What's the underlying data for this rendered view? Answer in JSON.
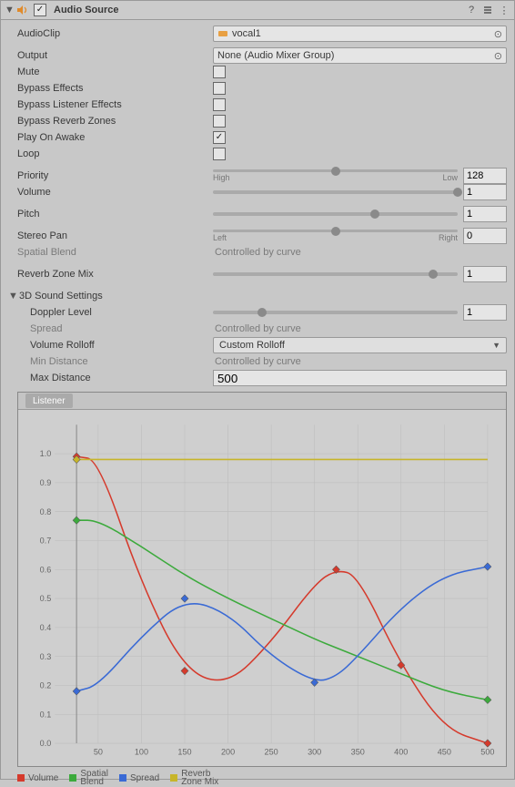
{
  "header": {
    "title": "Audio Source",
    "enabled": true
  },
  "audioClip": {
    "label": "AudioClip",
    "value": "vocal1"
  },
  "output": {
    "label": "Output",
    "value": "None (Audio Mixer Group)"
  },
  "mute": {
    "label": "Mute",
    "checked": false
  },
  "bypassEffects": {
    "label": "Bypass Effects",
    "checked": false
  },
  "bypassListener": {
    "label": "Bypass Listener Effects",
    "checked": false
  },
  "bypassReverb": {
    "label": "Bypass Reverb Zones",
    "checked": false
  },
  "playOnAwake": {
    "label": "Play On Awake",
    "checked": true
  },
  "loop": {
    "label": "Loop",
    "checked": false
  },
  "priority": {
    "label": "Priority",
    "value": "128",
    "min": "High",
    "max": "Low",
    "fraction": 0.5
  },
  "volume": {
    "label": "Volume",
    "value": "1",
    "fraction": 1.0
  },
  "pitch": {
    "label": "Pitch",
    "value": "1",
    "fraction": 0.66
  },
  "stereoPan": {
    "label": "Stereo Pan",
    "value": "0",
    "min": "Left",
    "max": "Right",
    "fraction": 0.5
  },
  "spatialBlend": {
    "label": "Spatial Blend",
    "value": "Controlled by curve"
  },
  "reverbZoneMix": {
    "label": "Reverb Zone Mix",
    "value": "1",
    "fraction": 0.9
  },
  "section3d": {
    "title": "3D Sound Settings"
  },
  "doppler": {
    "label": "Doppler Level",
    "value": "1",
    "fraction": 0.2
  },
  "spread": {
    "label": "Spread",
    "value": "Controlled by curve"
  },
  "volumeRolloff": {
    "label": "Volume Rolloff",
    "value": "Custom Rolloff"
  },
  "minDistance": {
    "label": "Min Distance",
    "value": "Controlled by curve"
  },
  "maxDistance": {
    "label": "Max Distance",
    "value": "500"
  },
  "curveTab": "Listener",
  "yTicks": [
    "1.0",
    "0.9",
    "0.8",
    "0.7",
    "0.6",
    "0.5",
    "0.4",
    "0.3",
    "0.2",
    "0.1",
    "0.0"
  ],
  "xTicks": [
    "50",
    "100",
    "150",
    "200",
    "250",
    "300",
    "350",
    "400",
    "450",
    "500"
  ],
  "legend": {
    "volume": "Volume",
    "spatial": "Spatial\nBlend",
    "spread": "Spread",
    "reverb": "Reverb\nZone Mix"
  },
  "chart_data": {
    "type": "line",
    "xlabel": "",
    "ylabel": "",
    "xlim": [
      0,
      500
    ],
    "ylim": [
      0,
      1.1
    ],
    "x": [
      25,
      50,
      100,
      150,
      200,
      250,
      300,
      325,
      350,
      400,
      450,
      500
    ],
    "series": [
      {
        "name": "Volume",
        "color": "#D53A2C",
        "values": [
          0.99,
          0.98,
          0.55,
          0.25,
          0.2,
          0.35,
          0.55,
          0.6,
          0.58,
          0.27,
          0.05,
          0.0
        ]
      },
      {
        "name": "Spatial Blend",
        "color": "#3CAA3C",
        "values": [
          0.77,
          0.77,
          0.68,
          0.58,
          0.5,
          0.43,
          0.36,
          0.33,
          0.3,
          0.24,
          0.18,
          0.15
        ]
      },
      {
        "name": "Spread",
        "color": "#3A6AD5",
        "values": [
          0.18,
          0.2,
          0.37,
          0.5,
          0.45,
          0.3,
          0.21,
          0.23,
          0.3,
          0.47,
          0.58,
          0.61
        ]
      },
      {
        "name": "Reverb Zone Mix",
        "color": "#C7B52A",
        "values": [
          0.98,
          0.98,
          0.98,
          0.98,
          0.98,
          0.98,
          0.98,
          0.98,
          0.98,
          0.98,
          0.98,
          0.98
        ]
      }
    ],
    "markers": {
      "Volume": [
        {
          "x": 25,
          "y": 0.99
        },
        {
          "x": 150,
          "y": 0.25
        },
        {
          "x": 325,
          "y": 0.6
        },
        {
          "x": 400,
          "y": 0.27
        },
        {
          "x": 500,
          "y": 0.0
        }
      ],
      "Spatial Blend": [
        {
          "x": 25,
          "y": 0.77
        },
        {
          "x": 500,
          "y": 0.15
        }
      ],
      "Spread": [
        {
          "x": 25,
          "y": 0.18
        },
        {
          "x": 150,
          "y": 0.5
        },
        {
          "x": 300,
          "y": 0.21
        },
        {
          "x": 500,
          "y": 0.61
        }
      ],
      "Reverb Zone Mix": [
        {
          "x": 25,
          "y": 0.98
        }
      ]
    }
  }
}
